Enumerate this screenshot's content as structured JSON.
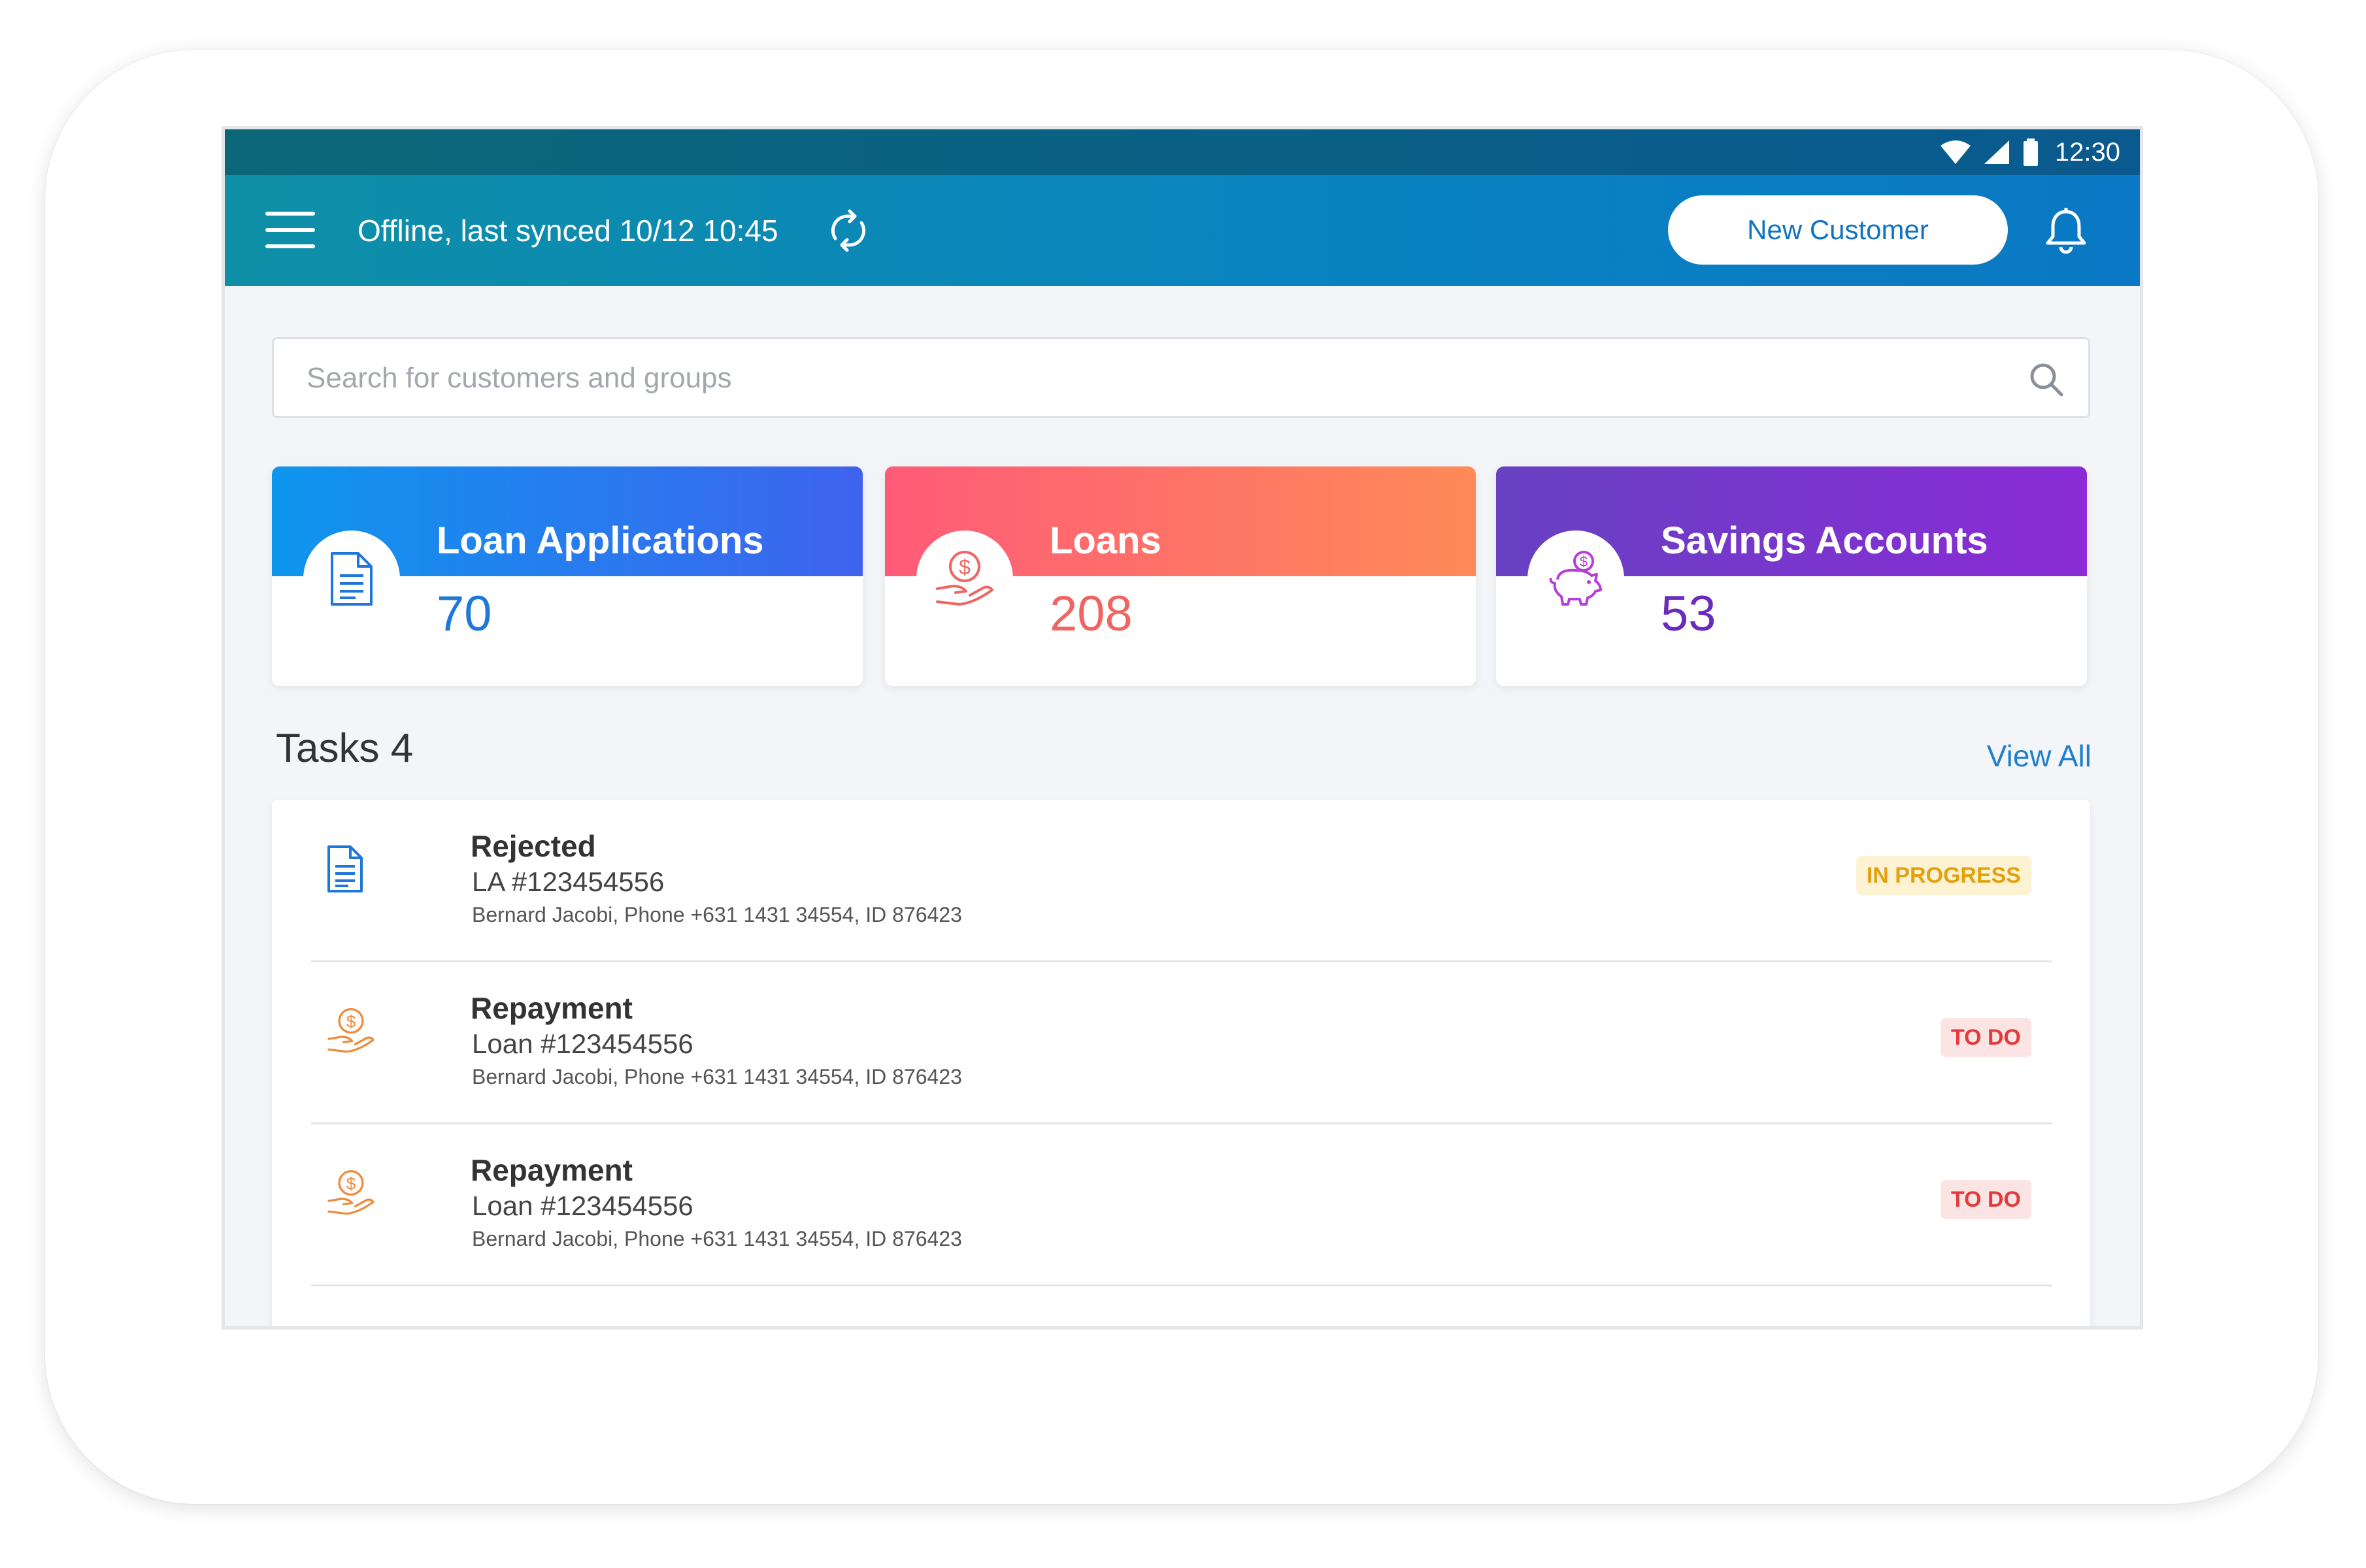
{
  "status_bar": {
    "time": "12:30"
  },
  "app_bar": {
    "sync_status": "Offline, last synced 10/12 10:45",
    "new_customer_label": "New Customer"
  },
  "search": {
    "placeholder": "Search for customers and groups"
  },
  "summary_cards": [
    {
      "title": "Loan Applications",
      "count": "70"
    },
    {
      "title": "Loans",
      "count": "208"
    },
    {
      "title": "Savings Accounts",
      "count": "53"
    }
  ],
  "tasks": {
    "title": "Tasks 4",
    "view_all_label": "View All",
    "items": [
      {
        "icon": "document-icon",
        "type": "Rejected",
        "reference": "LA #123454556",
        "details": "Bernard Jacobi, Phone +631 1431 34554, ID 876423",
        "status": "IN PROGRESS"
      },
      {
        "icon": "hand-coin-icon",
        "type": "Repayment",
        "reference": "Loan #123454556",
        "details": "Bernard Jacobi, Phone +631 1431 34554, ID 876423",
        "status": "TO DO"
      },
      {
        "icon": "hand-coin-icon",
        "type": "Repayment",
        "reference": "Loan #123454556",
        "details": "Bernard Jacobi, Phone +631 1431 34554, ID 876423",
        "status": "TO DO"
      }
    ]
  },
  "colors": {
    "app_bar": "#0a84c0",
    "status_bar": "#0b6778",
    "loan_applications": "#1f78d9",
    "loans": "#f06562",
    "savings_accounts": "#6b2bbd",
    "in_progress": "#e2a10f",
    "to_do": "#e23b3b",
    "link": "#1e7fd0"
  }
}
